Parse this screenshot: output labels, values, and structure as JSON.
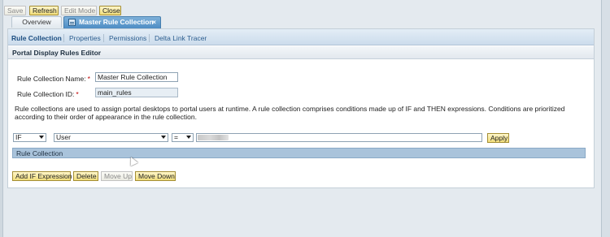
{
  "toolbar": {
    "save": "Save",
    "refresh": "Refresh",
    "edit_mode": "Edit Mode",
    "close": "Close"
  },
  "tabs": {
    "overview": "Overview",
    "active": "Master Rule Collection",
    "close_glyph": "×"
  },
  "subtabs": {
    "rule_collection": "Rule Collection",
    "properties": "Properties",
    "permissions": "Permissions",
    "delta_link_tracer": "Delta Link Tracer"
  },
  "editor": {
    "title": "Portal Display Rules Editor",
    "name_label": "Rule Collection Name:",
    "name_value": "Master Rule Collection",
    "id_label": "Rule Collection ID:",
    "id_value": "main_rules",
    "required_mark": "*",
    "description": "Rule collections are used to assign portal desktops to portal users at runtime. A rule collection comprises conditions made up of IF and THEN expressions. Conditions are prioritized according to their order of appearance in the rule collection."
  },
  "condition": {
    "keyword": "IF",
    "attribute": "User",
    "operator": "=",
    "apply": "Apply"
  },
  "rule_table": {
    "header": "Rule Collection"
  },
  "actions": {
    "add_if": "Add IF Expression",
    "delete": "Delete",
    "move_up": "Move Up",
    "move_down": "Move Down"
  }
}
